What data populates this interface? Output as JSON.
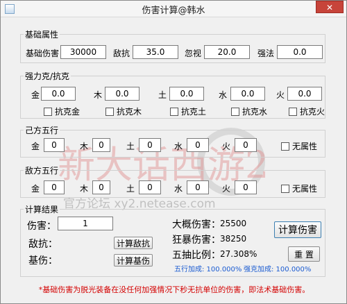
{
  "window": {
    "title": "伤害计算@韩水",
    "close_glyph": "✕"
  },
  "base": {
    "legend": "基础属性",
    "base_damage_label": "基础伤害",
    "base_damage_value": "30000",
    "resist_label": "敌抗",
    "resist_value": "35.0",
    "ignore_label": "忽视",
    "ignore_value": "20.0",
    "strong_label": "强法",
    "strong_value": "0.0"
  },
  "force": {
    "legend": "强力克/抗克",
    "elements": [
      {
        "label": "金",
        "value": "0.0",
        "check": "抗克金"
      },
      {
        "label": "木",
        "value": "0.0",
        "check": "抗克木"
      },
      {
        "label": "土",
        "value": "0.0",
        "check": "抗克土"
      },
      {
        "label": "水",
        "value": "0.0",
        "check": "抗克水"
      },
      {
        "label": "火",
        "value": "0.0",
        "check": "抗克火"
      }
    ]
  },
  "self_elements": {
    "legend": "己方五行",
    "items": [
      {
        "label": "金",
        "value": "0"
      },
      {
        "label": "木",
        "value": "0"
      },
      {
        "label": "土",
        "value": "0"
      },
      {
        "label": "水",
        "value": "0"
      },
      {
        "label": "火",
        "value": "0"
      }
    ],
    "none_label": "无属性"
  },
  "enemy_elements": {
    "legend": "敌方五行",
    "items": [
      {
        "label": "金",
        "value": "0"
      },
      {
        "label": "木",
        "value": "0"
      },
      {
        "label": "土",
        "value": "0"
      },
      {
        "label": "水",
        "value": "0"
      },
      {
        "label": "火",
        "value": "0"
      }
    ],
    "none_label": "无属性"
  },
  "result": {
    "legend": "计算结果",
    "damage_label": "伤害：",
    "damage_value": "1",
    "resist_label": "敌抗：",
    "resist_button": "计算敌抗",
    "base_label": "基伤：",
    "base_button": "计算基伤",
    "approx_label": "大概伤害：",
    "approx_value": "25500",
    "crit_label": "狂暴伤害：",
    "crit_value": "38250",
    "ratio_label": "五抽比例：",
    "ratio_value": "27.308%",
    "calc_button": "计算伤害",
    "reset_button": "重 置",
    "wuxing_bonus": "五行加成: 100.000%",
    "strong_bonus": "强克加成: 100.000%"
  },
  "watermark": {
    "main_text": "新大话西游2",
    "sub_text": "官方论坛 xy2.netease.com"
  },
  "footer_note": "*基础伤害为脱光装备在没任何加强情况下秒无抗单位的伤害，即法术基础伤害。"
}
